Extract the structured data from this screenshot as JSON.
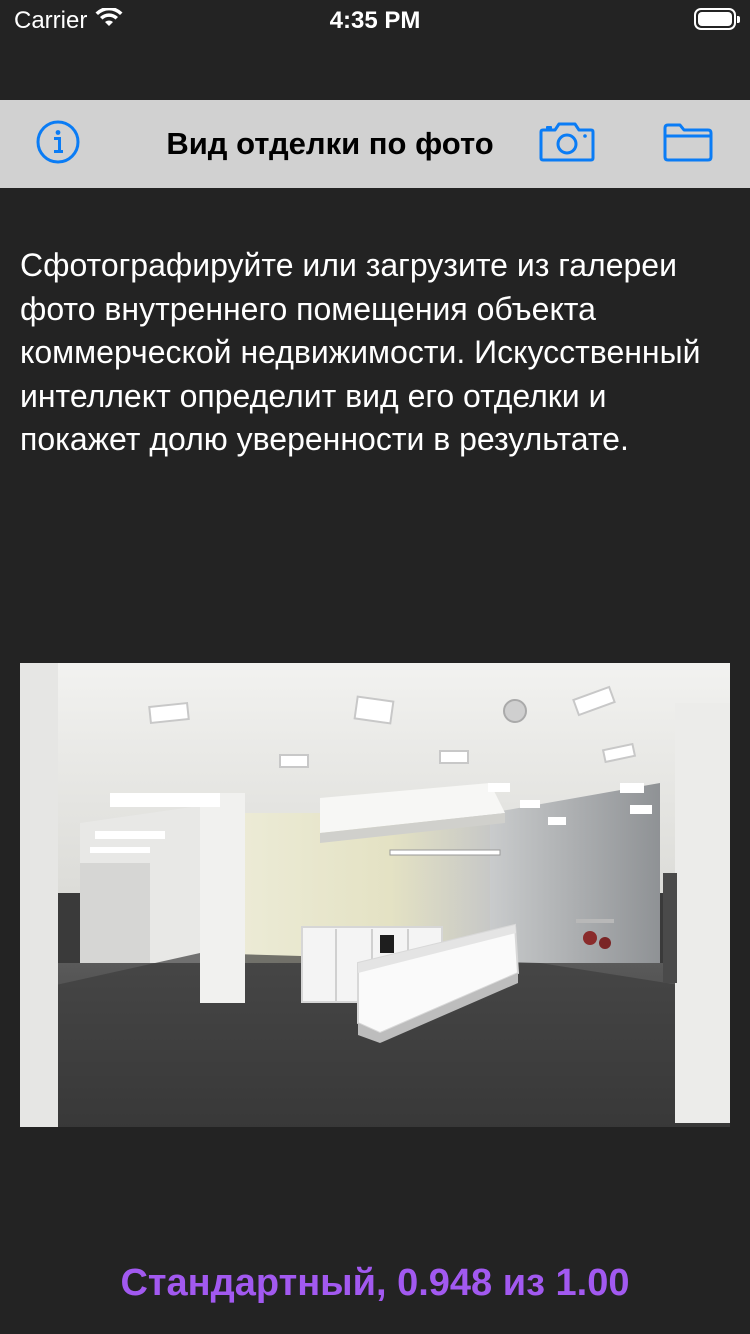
{
  "status_bar": {
    "carrier": "Carrier",
    "time": "4:35 PM"
  },
  "toolbar": {
    "title": "Вид отделки по фото",
    "info_icon": "info-icon",
    "camera_icon": "camera-icon",
    "folder_icon": "folder-icon",
    "accent_color": "#0a7cf5",
    "background": "#d1d1d1"
  },
  "description": "Сфотографируйте или загрузите из галереи фото внутреннего помещения объекта коммерческой недвижимости. Искусственный интеллект определит вид его отделки и покажет долю уверенности в результате.",
  "photo": {
    "subject": "office-interior-photo"
  },
  "result": {
    "text": "Стандартный, 0.948 из 1.00",
    "color": "#a259f0"
  }
}
